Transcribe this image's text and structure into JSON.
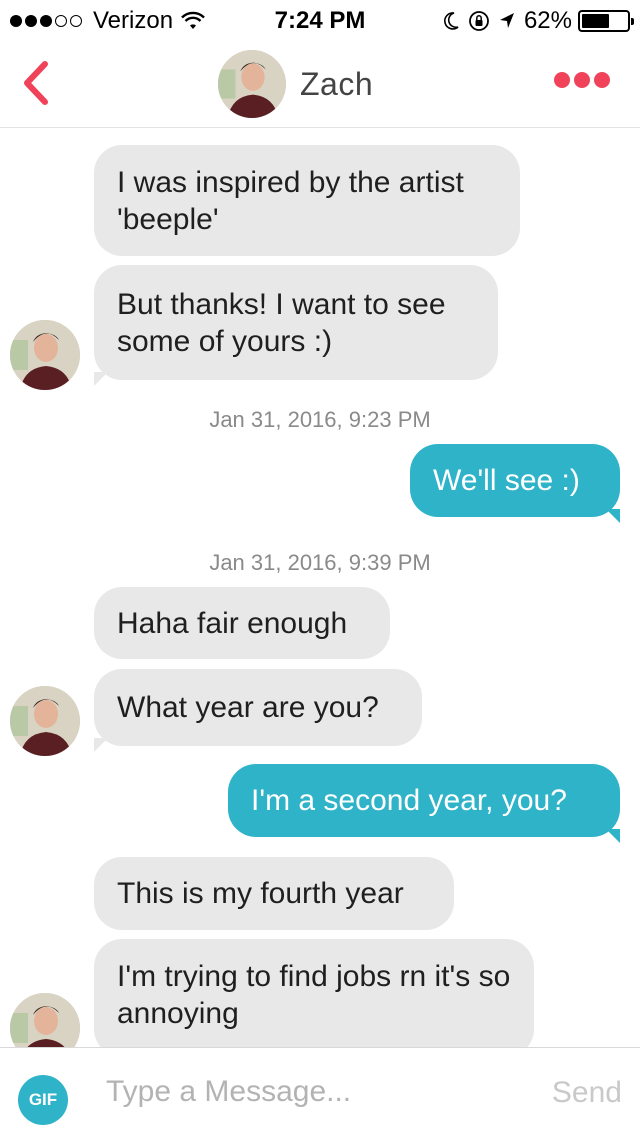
{
  "status_bar": {
    "carrier": "Verizon",
    "time": "7:24 PM",
    "battery": "62%",
    "battery_level": 0.62,
    "signal_bars_filled": 3,
    "signal_bars_total": 5
  },
  "header": {
    "contact_name": "Zach",
    "back_icon": "chevron-left-icon",
    "more_icon": "more-dots-icon",
    "accent_color": "#f0435a"
  },
  "messages": [
    {
      "from": "them",
      "text": "I was inspired by the artist 'beeple'"
    },
    {
      "from": "them",
      "text": "But thanks! I want to see some of yours :)"
    },
    {
      "type": "timestamp",
      "text": "Jan 31, 2016, 9:23 PM"
    },
    {
      "from": "me",
      "text": "We'll see :)"
    },
    {
      "type": "timestamp",
      "text": "Jan 31, 2016, 9:39 PM"
    },
    {
      "from": "them",
      "text": "Haha fair enough"
    },
    {
      "from": "them",
      "text": "What year are you?"
    },
    {
      "from": "me",
      "text": "I'm a second year, you?"
    },
    {
      "from": "them",
      "text": "This is my fourth year"
    },
    {
      "from": "them",
      "text": "I'm trying to find jobs rn it's so annoying"
    }
  ],
  "input_bar": {
    "gif_label": "GIF",
    "placeholder": "Type a Message...",
    "value": "",
    "send_label": "Send"
  },
  "colors": {
    "outgoing_bubble": "#2fb3c9",
    "incoming_bubble": "#e8e8e8"
  }
}
